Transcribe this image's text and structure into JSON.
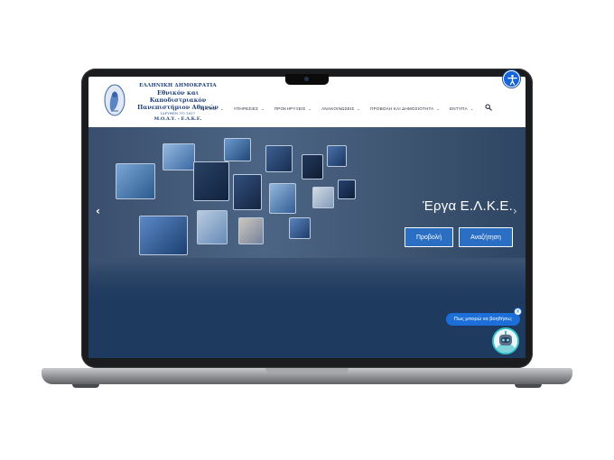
{
  "header": {
    "logo_lines": [
      "ΕΛΛΗΝΙΚΗ ΔΗΜΟΚΡΑΤΙΑ",
      "Εθνικόν και Καποδιστριακόν",
      "Πανεπιστήμιον Αθηνών",
      "ΙΔΡΥΘΕΝ ΤΟ 1837",
      "Μ.Ο.Δ.Υ. - Ε.Λ.Κ.Ε."
    ],
    "nav": [
      {
        "label": "Ε.Λ.Κ.Ε."
      },
      {
        "label": "ΥΠΗΡΕΣΙΕΣ"
      },
      {
        "label": "ΠΡΟΚΗΡΥΞΕΙΣ"
      },
      {
        "label": "ΑΝΑΚΟΙΝΩΣΕΙΣ"
      },
      {
        "label": "ΠΡΟΒΟΛΗ ΚΑΙ ΔΗΜΟΣΙΟΤΗΤΑ"
      },
      {
        "label": "ΕΝΤΥΠΑ"
      }
    ],
    "search_icon": "search-icon",
    "chevron": "⌄"
  },
  "accessibility": {
    "icon": "accessibility-icon"
  },
  "hero": {
    "title": "Έργα Ε.Λ.Κ.Ε.",
    "view_button": "Προβολή",
    "search_button": "Αναζήτηση",
    "prev_arrow": "‹",
    "next_arrow": "›"
  },
  "chat": {
    "prompt": "Πως μπορώ να βοηθήσω;",
    "close": "×",
    "avatar_icon": "robot-icon"
  },
  "colors": {
    "accent": "#2b6fc5",
    "hero_bg": "#1e3a5f",
    "chat_blue": "#1c6fd8",
    "bot_teal": "#34c0c9"
  }
}
